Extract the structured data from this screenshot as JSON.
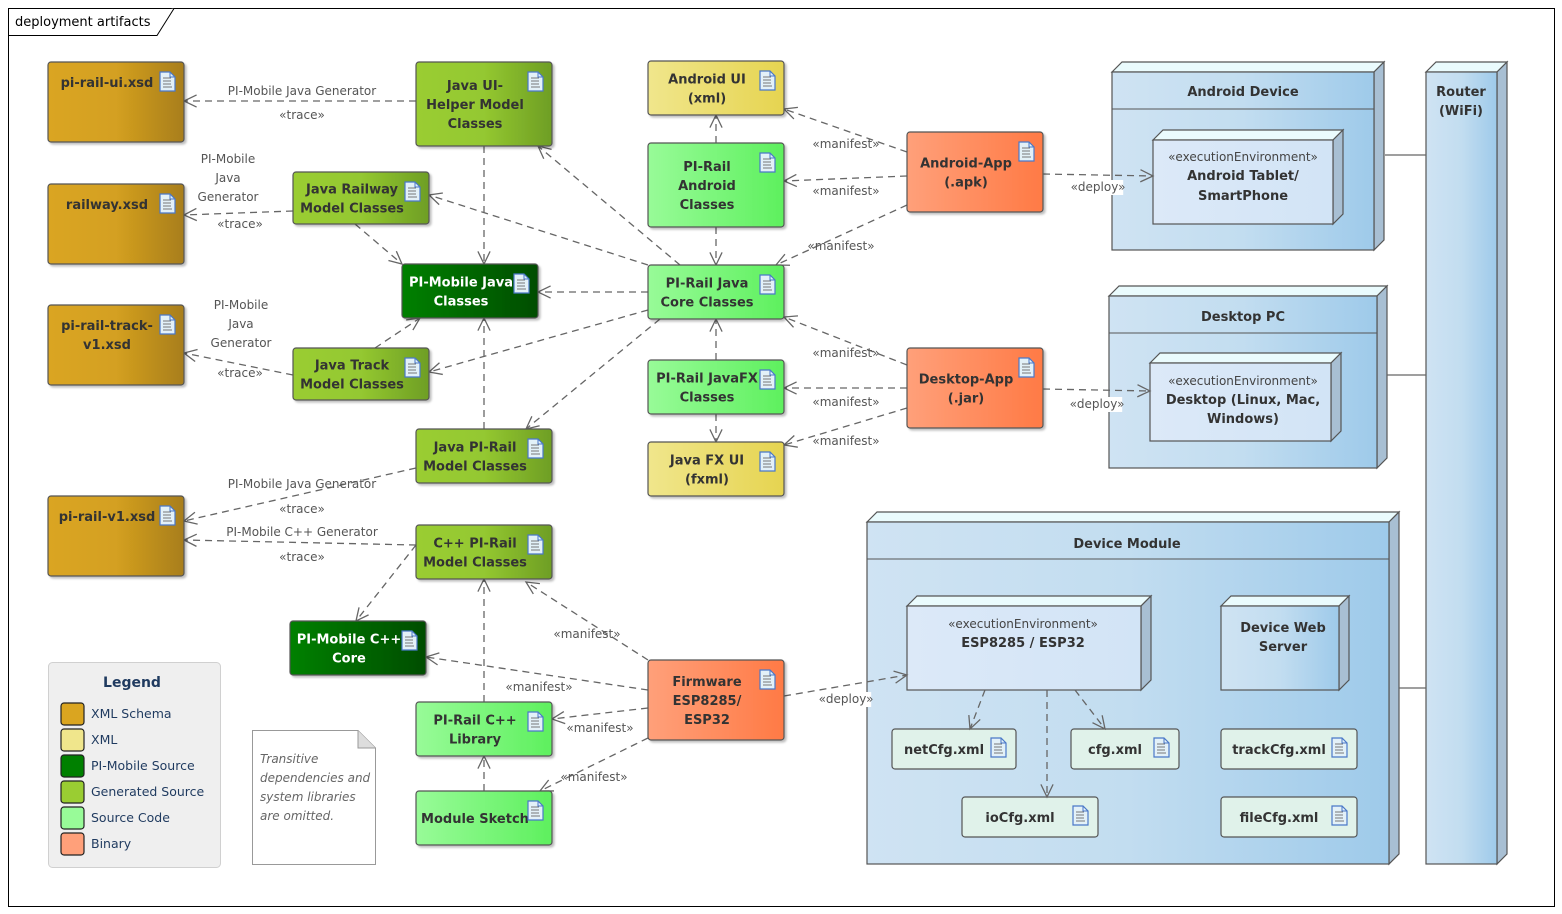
{
  "frame": {
    "title": "deployment artifacts"
  },
  "colors": {
    "xml_schema": "#DAA520",
    "xml": "#F0E68C",
    "pi_mobile_source": "#008000",
    "generated_source": "#9ACD32",
    "source_code": "#98FB98",
    "binary": "#FFA07A",
    "node": "#C6DDF0",
    "config": "#E0F2EA"
  },
  "artifacts": {
    "pi_rail_ui_xsd": {
      "lines": [
        "pi-rail-ui.xsd"
      ],
      "kind": "xml_schema"
    },
    "railway_xsd": {
      "lines": [
        "railway.xsd"
      ],
      "kind": "xml_schema"
    },
    "pi_rail_track_xsd": {
      "lines": [
        "pi-rail-track-",
        "v1.xsd"
      ],
      "kind": "xml_schema"
    },
    "pi_rail_v1_xsd": {
      "lines": [
        "pi-rail-v1.xsd"
      ],
      "kind": "xml_schema"
    },
    "java_ui_helper": {
      "lines": [
        "Java UI-",
        "Helper Model",
        "Classes"
      ],
      "kind": "generated_source"
    },
    "java_railway": {
      "lines": [
        "Java Railway",
        "Model Classes"
      ],
      "kind": "generated_source"
    },
    "java_track": {
      "lines": [
        "Java Track",
        "Model Classes"
      ],
      "kind": "generated_source"
    },
    "java_pirail": {
      "lines": [
        "Java PI-Rail",
        "Model Classes"
      ],
      "kind": "generated_source"
    },
    "cpp_pirail": {
      "lines": [
        "C++ PI-Rail",
        "Model Classes"
      ],
      "kind": "generated_source"
    },
    "pi_mobile_java": {
      "lines": [
        "PI-Mobile Java",
        "Classes"
      ],
      "kind": "pi_mobile_source"
    },
    "pi_mobile_cpp": {
      "lines": [
        "PI-Mobile C++",
        "Core"
      ],
      "kind": "pi_mobile_source"
    },
    "android_ui": {
      "lines": [
        "Android UI",
        "(xml)"
      ],
      "kind": "xml"
    },
    "pirail_android": {
      "lines": [
        "PI-Rail",
        "Android",
        "Classes"
      ],
      "kind": "source_code"
    },
    "pirail_java_core": {
      "lines": [
        "PI-Rail Java",
        "Core Classes"
      ],
      "kind": "source_code"
    },
    "pirail_javafx": {
      "lines": [
        "PI-Rail JavaFX",
        "Classes"
      ],
      "kind": "source_code"
    },
    "javafx_ui": {
      "lines": [
        "Java FX UI",
        "(fxml)"
      ],
      "kind": "xml"
    },
    "pirail_cpp_lib": {
      "lines": [
        "PI-Rail C++",
        "Library"
      ],
      "kind": "source_code"
    },
    "module_sketch": {
      "lines": [
        "Module Sketch"
      ],
      "kind": "source_code"
    },
    "android_app": {
      "lines": [
        "Android-App",
        "(.apk)"
      ],
      "kind": "binary"
    },
    "desktop_app": {
      "lines": [
        "Desktop-App",
        "(.jar)"
      ],
      "kind": "binary"
    },
    "firmware": {
      "lines": [
        "Firmware",
        "ESP8285/",
        "ESP32"
      ],
      "kind": "binary"
    }
  },
  "nodes": {
    "android_device": {
      "title": "Android Device"
    },
    "android_env": {
      "stereotype": "«executionEnvironment»",
      "lines": [
        "Android Tablet/",
        "SmartPhone"
      ]
    },
    "desktop_pc": {
      "title": "Desktop PC"
    },
    "desktop_env": {
      "stereotype": "«executionEnvironment»",
      "lines": [
        "Desktop (Linux, Mac,",
        "Windows)"
      ]
    },
    "device_module": {
      "title": "Device Module"
    },
    "esp_env": {
      "stereotype": "«executionEnvironment»",
      "lines": [
        "ESP8285 / ESP32"
      ]
    },
    "web_server": {
      "lines": [
        "Device Web",
        "Server"
      ]
    },
    "router": {
      "lines": [
        "Router",
        "(WiFi)"
      ]
    }
  },
  "config_files": {
    "netcfg": "netCfg.xml",
    "cfg": "cfg.xml",
    "trackcfg": "trackCfg.xml",
    "iocfg": "ioCfg.xml",
    "filecfg": "fileCfg.xml"
  },
  "edge_labels": {
    "java_gen": "PI-Mobile Java Generator",
    "cpp_gen": "PI-Mobile C++ Generator",
    "java_gen_lines": [
      "PI-Mobile",
      "Java",
      "Generator"
    ],
    "trace": "«trace»",
    "manifest": "«manifest»",
    "deploy": "«deploy»"
  },
  "legend": {
    "title": "Legend",
    "items": [
      {
        "label": "XML Schema",
        "color": "#DAA520"
      },
      {
        "label": "XML",
        "color": "#F0E68C"
      },
      {
        "label": "PI-Mobile Source",
        "color": "#008000"
      },
      {
        "label": "Generated Source",
        "color": "#9ACD32"
      },
      {
        "label": "Source Code",
        "color": "#98FB98"
      },
      {
        "label": "Binary",
        "color": "#FFA07A"
      }
    ]
  },
  "note": {
    "lines": [
      "Transitive",
      "dependencies and",
      "system libraries",
      "are omitted."
    ]
  }
}
